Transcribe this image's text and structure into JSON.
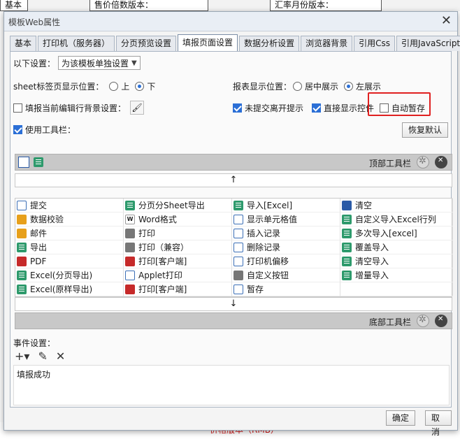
{
  "background": {
    "top_cells": [
      "基本",
      "售价倍数版本：",
      "汇率月份版本："
    ],
    "bottom_text": "价格版本（RMB）"
  },
  "dialog": {
    "title": "模板Web属性",
    "close_label": "✕"
  },
  "tabs": [
    {
      "label": "基本",
      "active": false
    },
    {
      "label": "打印机（服务器）",
      "active": false
    },
    {
      "label": "分页预览设置",
      "active": false
    },
    {
      "label": "填报页面设置",
      "active": true
    },
    {
      "label": "数据分析设置",
      "active": false
    },
    {
      "label": "浏览器背景",
      "active": false
    },
    {
      "label": "引用Css",
      "active": false
    },
    {
      "label": "引用JavaScript",
      "active": false
    }
  ],
  "settings": {
    "scope_label": "以下设置：",
    "scope_value": "为该模板单独设置",
    "sheet_pos_label": "sheet标签页显示位置：",
    "sheet_pos_up": "上",
    "sheet_pos_down": "下",
    "report_pos_label": "报表显示位置：",
    "report_pos_center": "居中展示",
    "report_pos_left": "左展示",
    "fill_row_bg": "填报当前编辑行背景设置：",
    "unsubmitted_leave": "未提交离开提示",
    "show_controls": "直接显示控件",
    "auto_save": "自动暂存",
    "use_toolbar": "使用工具栏：",
    "restore_default": "恢复默认"
  },
  "toolbar": {
    "top_label": "顶部工具栏",
    "bottom_label": "底部工具栏",
    "up_arrow": "↑",
    "down_arrow": "↓",
    "items": [
      {
        "label": "提交",
        "icon": "submit-icon"
      },
      {
        "label": "分页分Sheet导出",
        "icon": "excel-icon"
      },
      {
        "label": "导入[Excel]",
        "icon": "excel-icon"
      },
      {
        "label": "清空",
        "icon": "eraser-icon"
      },
      {
        "label": "数据校验",
        "icon": "pencil-icon"
      },
      {
        "label": "Word格式",
        "icon": "word-icon"
      },
      {
        "label": "显示单元格值",
        "icon": "cell-icon"
      },
      {
        "label": "自定义导入Excel行列",
        "icon": "excel-icon"
      },
      {
        "label": "邮件",
        "icon": "mail-icon"
      },
      {
        "label": "打印",
        "icon": "printer-icon"
      },
      {
        "label": "插入记录",
        "icon": "insert-row-icon"
      },
      {
        "label": "多次导入[excel]",
        "icon": "excel-icon"
      },
      {
        "label": "导出",
        "icon": "export-icon"
      },
      {
        "label": "打印（兼容）",
        "icon": "printer-icon"
      },
      {
        "label": "删除记录",
        "icon": "delete-row-icon"
      },
      {
        "label": "覆盖导入",
        "icon": "excel-icon"
      },
      {
        "label": "PDF",
        "icon": "pdf-icon"
      },
      {
        "label": "打印[客户端]",
        "icon": "pdf-icon"
      },
      {
        "label": "打印机偏移",
        "icon": "move-icon"
      },
      {
        "label": "清空导入",
        "icon": "excel-icon"
      },
      {
        "label": "Excel(分页导出)",
        "icon": "excel-icon"
      },
      {
        "label": "Applet打印",
        "icon": "applet-icon"
      },
      {
        "label": "自定义按钮",
        "icon": "gear-icon"
      },
      {
        "label": "增量导入",
        "icon": "excel-icon"
      },
      {
        "label": "Excel(原样导出)",
        "icon": "excel-icon"
      },
      {
        "label": "打印[客户端]",
        "icon": "pdf-icon"
      },
      {
        "label": "暂存",
        "icon": "save-icon"
      },
      {
        "label": "",
        "icon": ""
      }
    ]
  },
  "events": {
    "title": "事件设置：",
    "items": [
      "填报成功"
    ]
  },
  "footer": {
    "ok": "确定",
    "cancel": "取消"
  }
}
